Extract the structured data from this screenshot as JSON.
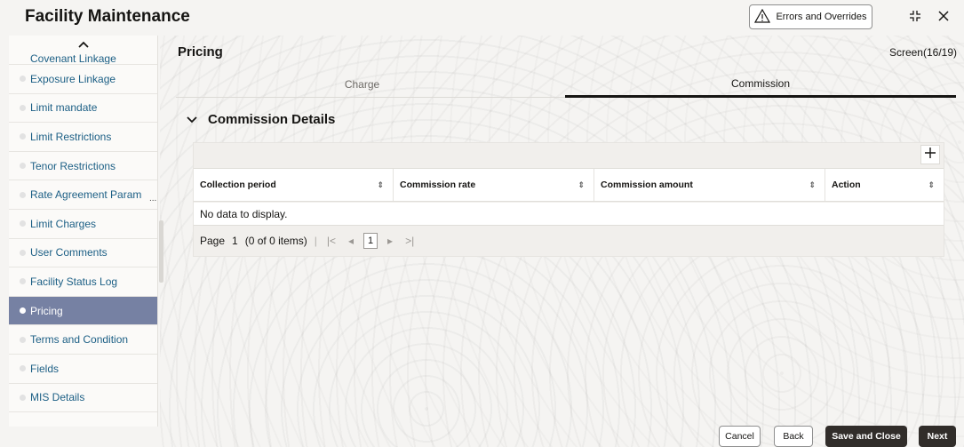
{
  "app": {
    "title": "Facility Maintenance",
    "errors_button": "Errors and Overrides"
  },
  "sidebar": {
    "items": [
      {
        "label": "Covenant Linkage",
        "partial": true
      },
      {
        "label": "Exposure Linkage"
      },
      {
        "label": "Limit mandate"
      },
      {
        "label": "Limit Restrictions"
      },
      {
        "label": "Tenor Restrictions"
      },
      {
        "label": "Rate Agreement Param",
        "ellipsis": "..."
      },
      {
        "label": "Limit Charges"
      },
      {
        "label": "User Comments"
      },
      {
        "label": "Facility Status Log"
      },
      {
        "label": "Pricing",
        "active": true
      },
      {
        "label": "Terms and Condition"
      },
      {
        "label": "Fields"
      },
      {
        "label": "MIS Details"
      }
    ]
  },
  "main": {
    "title": "Pricing",
    "screen_indicator": "Screen(16/19)",
    "tabs": [
      {
        "label": "Charge",
        "active": false
      },
      {
        "label": "Commission",
        "active": true
      }
    ],
    "section_title": "Commission Details",
    "table": {
      "columns": [
        "Collection period",
        "Commission rate",
        "Commission amount",
        "Action"
      ],
      "empty_text": "No data to display.",
      "pagination": {
        "page_label": "Page",
        "page_number": "1",
        "items_text": "(0 of 0 items)",
        "current_page": "1"
      }
    }
  },
  "footer": {
    "cancel": "Cancel",
    "back": "Back",
    "save_close": "Save and Close",
    "next": "Next"
  },
  "colors": {
    "active_nav": "#7681a3",
    "link_text": "#1c5f85",
    "primary_button": "#312d2a"
  }
}
